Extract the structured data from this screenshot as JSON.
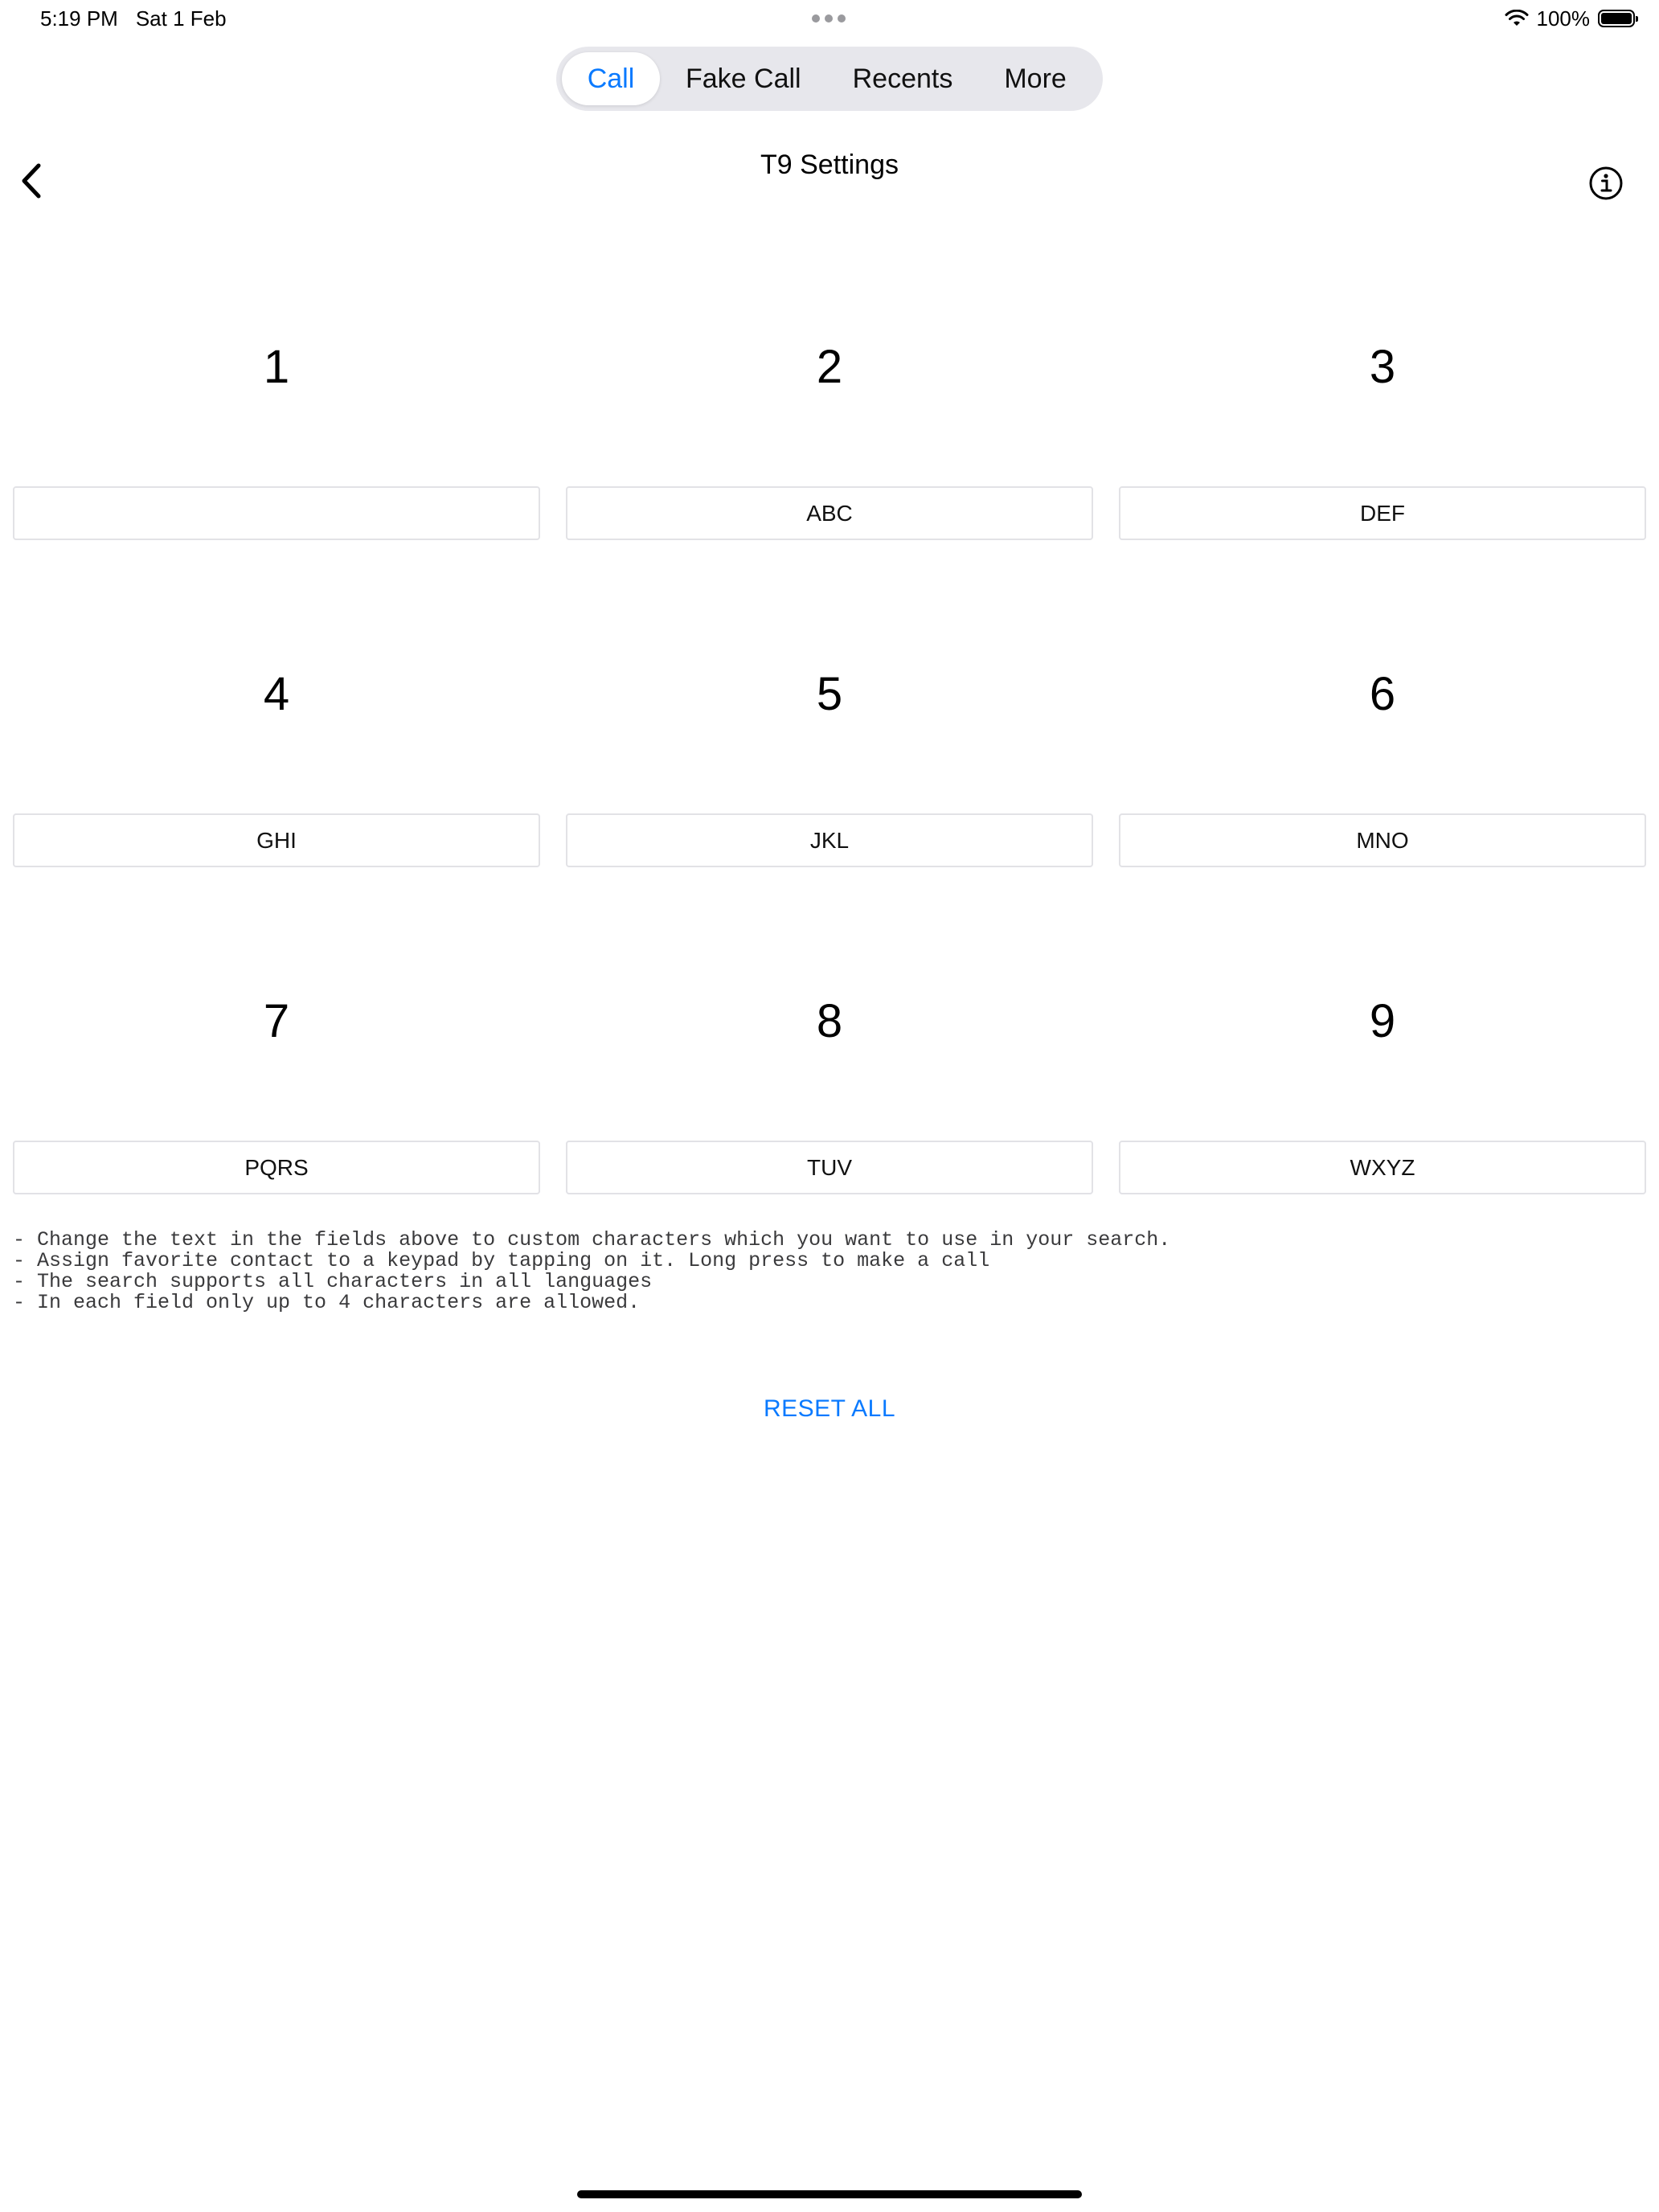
{
  "status_bar": {
    "time": "5:19 PM",
    "date": "Sat 1 Feb",
    "battery": "100%",
    "battery_level": 1.0
  },
  "tabs": [
    {
      "label": "Call",
      "active": true
    },
    {
      "label": "Fake Call",
      "active": false
    },
    {
      "label": "Recents",
      "active": false
    },
    {
      "label": "More",
      "active": false
    }
  ],
  "header": {
    "title": "T9 Settings",
    "back_icon": "chevron-left-icon",
    "info_icon": "info-circle-icon"
  },
  "keypad": [
    {
      "digit": "1",
      "letters": ""
    },
    {
      "digit": "2",
      "letters": "ABC"
    },
    {
      "digit": "3",
      "letters": "DEF"
    },
    {
      "digit": "4",
      "letters": "GHI"
    },
    {
      "digit": "5",
      "letters": "JKL"
    },
    {
      "digit": "6",
      "letters": "MNO"
    },
    {
      "digit": "7",
      "letters": "PQRS"
    },
    {
      "digit": "8",
      "letters": "TUV"
    },
    {
      "digit": "9",
      "letters": "WXYZ"
    }
  ],
  "notes": [
    "- Change the text in the fields above to custom characters which you want to use in your search.",
    "- Assign favorite contact to a keypad by tapping on it. Long press to make a call",
    "- The search supports all characters in all languages",
    "- In each field only up to 4 characters are allowed."
  ],
  "reset_label": "RESET ALL",
  "colors": {
    "accent": "#0a7aff",
    "segment_bg": "#e7e7ec",
    "field_border": "#e2e2e6"
  }
}
